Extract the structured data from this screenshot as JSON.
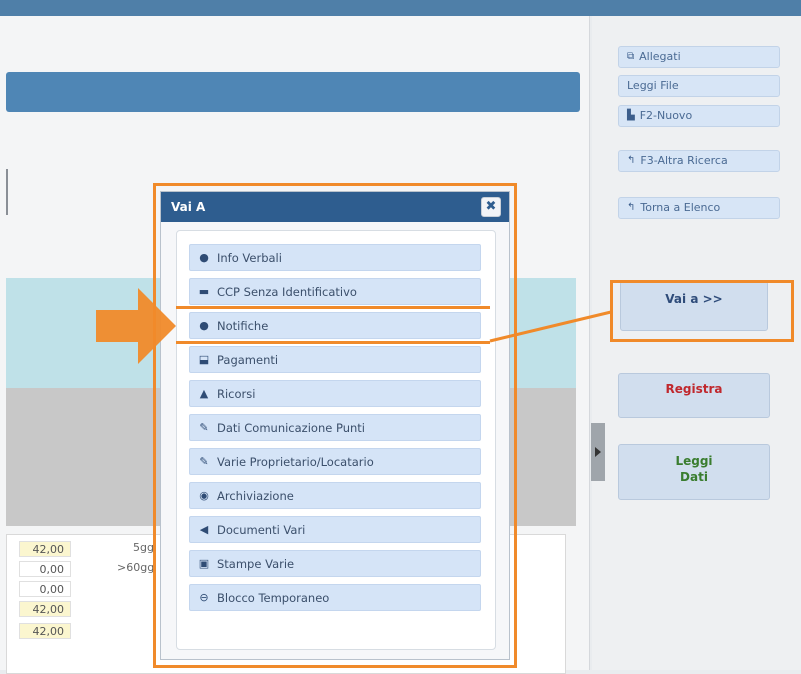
{
  "right_panel": {
    "allegati": {
      "label": "Allegati",
      "icon": "paperclip-icon"
    },
    "leggi_file": {
      "label": "Leggi File"
    },
    "f2_nuovo": {
      "label": "F2-Nuovo",
      "icon": "file-icon"
    },
    "f3_altra_ricerca": {
      "label": "F3-Altra Ricerca",
      "icon": "undo-icon"
    },
    "torna_elenco": {
      "label": "Torna a Elenco",
      "icon": "undo-icon"
    },
    "vai_a": {
      "label": "Vai a >>"
    },
    "registra": {
      "label": "Registra",
      "color": "#c0282d"
    },
    "leggi_dati": {
      "label_line1": "Leggi",
      "label_line2": "Dati",
      "color": "#3a7d2f"
    }
  },
  "background_values": {
    "values": [
      "42,00",
      "0,00",
      "0,00",
      "42,00",
      "42,00"
    ],
    "side_labels": [
      "5gg",
      ">60gg"
    ]
  },
  "dialog": {
    "title": "Vai A",
    "close_glyph": "✖",
    "items": [
      {
        "label": "Info Verbali",
        "icon": "info-circle-icon",
        "glyph": "●"
      },
      {
        "label": "CCP Senza Identificativo",
        "icon": "credit-card-icon",
        "glyph": "▬"
      },
      {
        "label": "Notifiche",
        "icon": "question-circle-icon",
        "glyph": "●"
      },
      {
        "label": "Pagamenti",
        "icon": "inbox-icon",
        "glyph": "⬓"
      },
      {
        "label": "Ricorsi",
        "icon": "warning-icon",
        "glyph": "▲"
      },
      {
        "label": "Dati Comunicazione Punti",
        "icon": "pencil-icon",
        "glyph": "✎"
      },
      {
        "label": "Varie Proprietario/Locatario",
        "icon": "pencil-icon",
        "glyph": "✎"
      },
      {
        "label": "Archiviazione",
        "icon": "circle-dot-icon",
        "glyph": "◉"
      },
      {
        "label": "Documenti Vari",
        "icon": "bullhorn-icon",
        "glyph": "◀"
      },
      {
        "label": "Stampe Varie",
        "icon": "print-icon",
        "glyph": "▣"
      },
      {
        "label": "Blocco Temporaneo",
        "icon": "minus-circle-icon",
        "glyph": "⊖"
      }
    ]
  },
  "colors": {
    "highlight": "#f08a2a",
    "dialog_title_bg": "#2e5d8f",
    "menu_item_bg": "#d5e4f7"
  }
}
